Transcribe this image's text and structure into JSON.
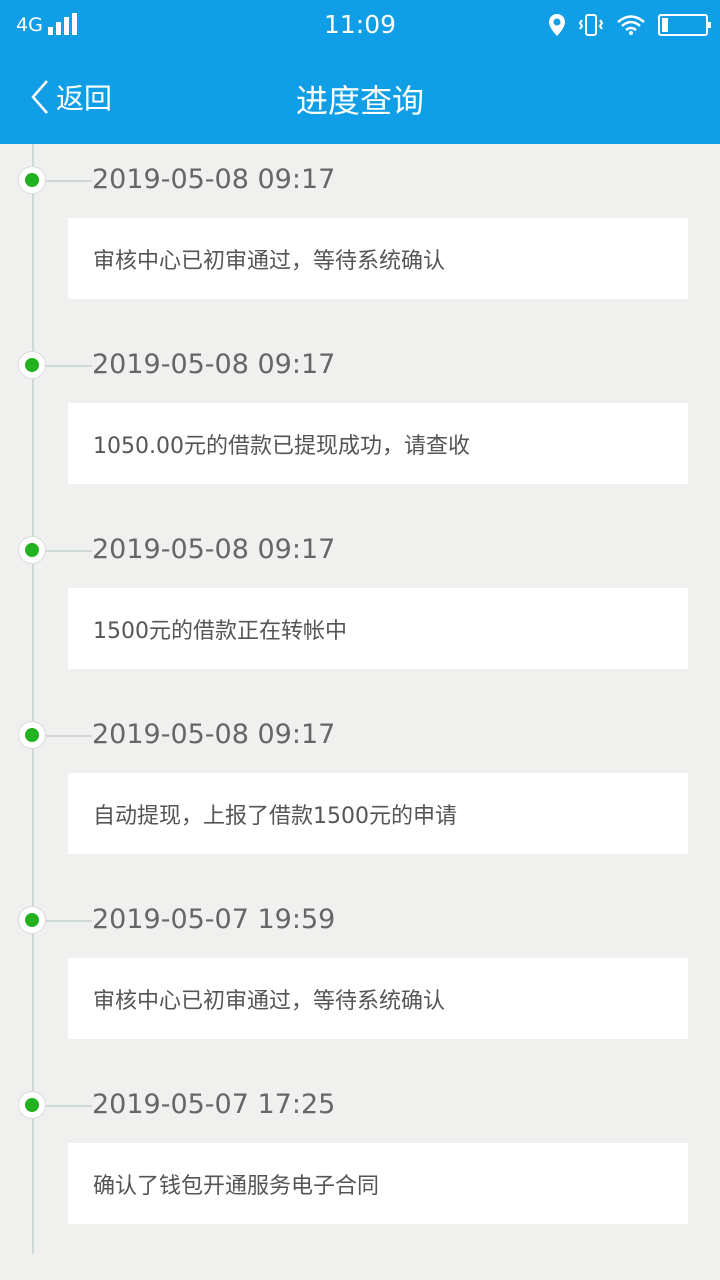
{
  "status_bar": {
    "network": "4G",
    "time": "11:09"
  },
  "header": {
    "back_label": "返回",
    "title": "进度查询"
  },
  "timeline": [
    {
      "timestamp": "2019-05-08 09:17",
      "message": "审核中心已初审通过，等待系统确认"
    },
    {
      "timestamp": "2019-05-08 09:17",
      "message": "1050.00元的借款已提现成功，请查收"
    },
    {
      "timestamp": "2019-05-08 09:17",
      "message": "1500元的借款正在转帐中"
    },
    {
      "timestamp": "2019-05-08 09:17",
      "message": "自动提现，上报了借款1500元的申请"
    },
    {
      "timestamp": "2019-05-07 19:59",
      "message": "审核中心已初审通过，等待系统确认"
    },
    {
      "timestamp": "2019-05-07 17:25",
      "message": "确认了钱包开通服务电子合同"
    }
  ],
  "colors": {
    "header": "#109ee6",
    "dot": "#22b11f",
    "background": "#f0f1ef"
  }
}
